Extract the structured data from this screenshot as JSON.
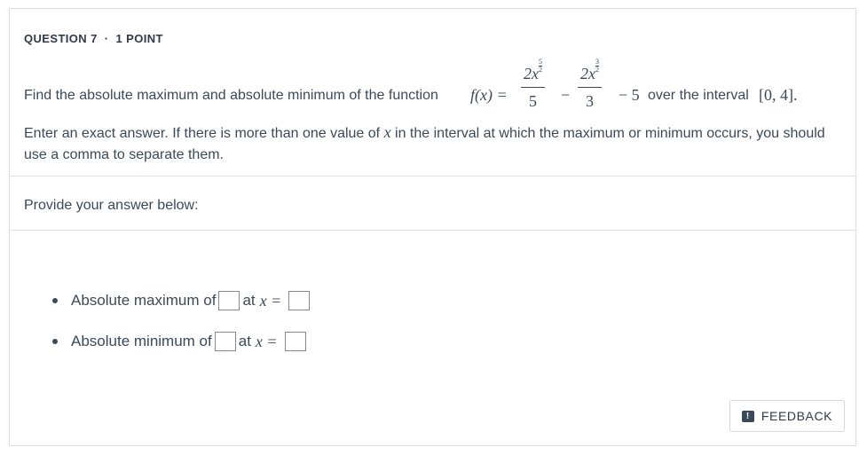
{
  "question": {
    "number_label": "QUESTION 7",
    "separator": "·",
    "points_label": "1 POINT",
    "lead_text": "Find the absolute maximum and absolute minimum of the function",
    "function_name": "f(x) =",
    "term1": {
      "coef": "2x",
      "exp_num": "5",
      "exp_den": "2",
      "denominator": "5"
    },
    "minus": "−",
    "term2": {
      "coef": "2x",
      "exp_num": "3",
      "exp_den": "2",
      "denominator": "3"
    },
    "const_part": "− 5",
    "interval_text": "over the interval",
    "interval": "[0, 4].",
    "instruction_pre": "Enter an exact answer. If there is more than one value of",
    "instruction_var": "x",
    "instruction_post": "in the interval at which the maximum or minimum occurs, you should use a comma to separate them."
  },
  "prompt_label": "Provide your answer below:",
  "answers": [
    {
      "label": "Absolute maximum of",
      "at_label": "at",
      "var_label": "x =",
      "value_placeholder": "",
      "x_placeholder": ""
    },
    {
      "label": "Absolute minimum of",
      "at_label": "at",
      "var_label": "x =",
      "value_placeholder": "",
      "x_placeholder": ""
    }
  ],
  "feedback": {
    "label": "FEEDBACK",
    "icon": "feedback-icon",
    "icon_glyph": "!"
  }
}
